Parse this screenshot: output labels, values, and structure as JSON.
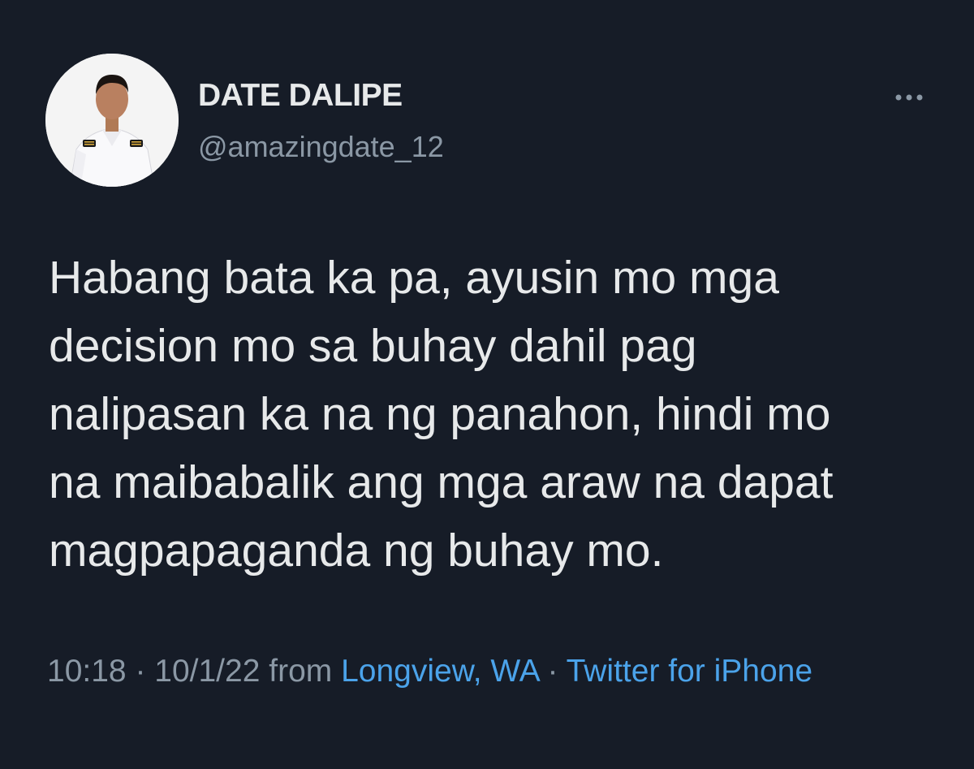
{
  "user": {
    "display_name": "DATE DALIPE",
    "handle": "@amazingdate_12",
    "avatar_icon": "profile-photo"
  },
  "actions": {
    "more_icon": "more-horizontal-icon"
  },
  "tweet": {
    "lines": [
      "Habang bata ka pa, ayusin mo mga",
      "decision mo sa buhay dahil pag",
      "nalipasan ka na ng panahon, hindi mo",
      "na maibabalik ang mga araw na dapat",
      "magpapaganda ng buhay mo."
    ]
  },
  "meta": {
    "time": "10:18",
    "separator_1": " · ",
    "date": "10/1/22",
    "from_text": " from ",
    "location": "Longview, WA",
    "separator_2": " · ",
    "source": "Twitter for iPhone"
  },
  "colors": {
    "background": "#161c27",
    "text_primary": "#e7e9ea",
    "text_secondary": "#8b98a5",
    "link": "#4ba3ea"
  }
}
